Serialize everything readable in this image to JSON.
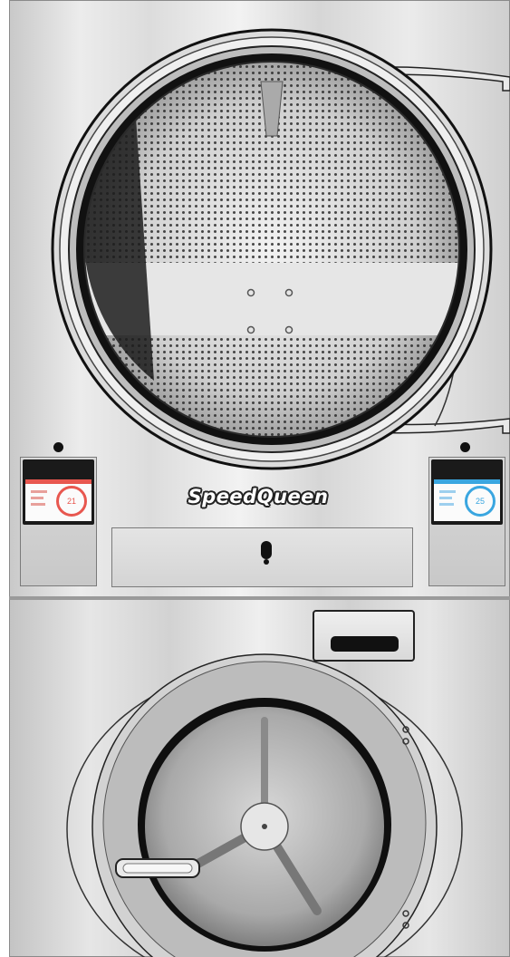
{
  "brand": {
    "name": "SpeedQueen"
  },
  "displays": {
    "left": {
      "value": "21",
      "accent_color": "#e8574f"
    },
    "right": {
      "value": "25",
      "accent_color": "#3aa6e0"
    }
  },
  "colors": {
    "steel_light": "#ececec",
    "steel_dark": "#c4c4c4",
    "outline": "#111111"
  }
}
